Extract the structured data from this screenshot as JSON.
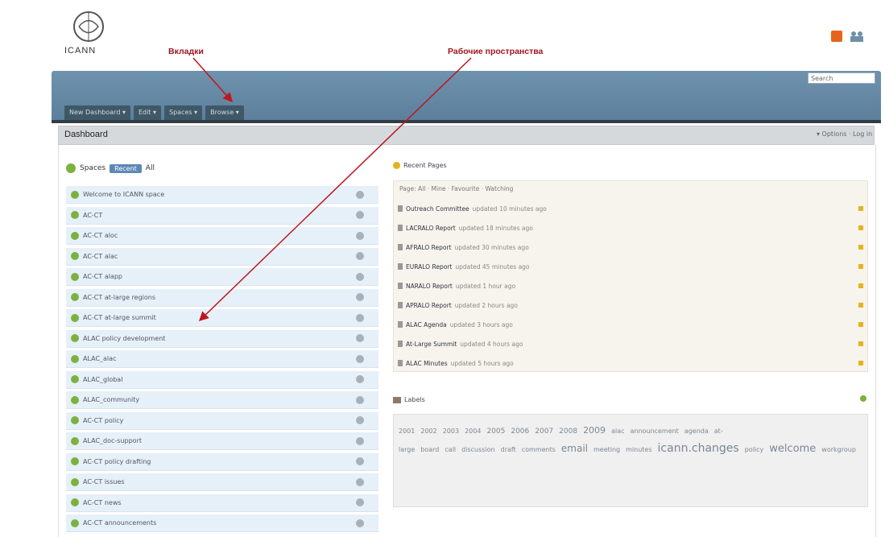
{
  "annotations": {
    "tabs": "Вкладки",
    "workspaces": "Рабочие пространства"
  },
  "logo_text": "ICANN",
  "search": {
    "placeholder": "Search"
  },
  "tabs": [
    "New Dashboard ▾",
    "Edit ▾",
    "Spaces ▾",
    "Browse ▾"
  ],
  "dashboard": {
    "title": "Dashboard",
    "right": "▾ Options · Log in"
  },
  "spaces": {
    "label": "Spaces",
    "filter_active": "Recent",
    "filter_other": "All",
    "items": [
      "Welcome to ICANN space",
      "AC-CT",
      "AC-CT aloc",
      "AC-CT alac",
      "AC-CT alapp",
      "AC-CT at-large regions",
      "AC-CT at-large summit",
      "ALAC policy development",
      "ALAC_alac",
      "ALAC_global",
      "ALAC_community",
      "AC-CT policy",
      "ALAC_doc-support",
      "AC-CT policy drafting",
      "AC-CT issues",
      "AC-CT news",
      "AC-CT announcements"
    ]
  },
  "pages": {
    "title": "Recent Pages",
    "filter": "Page: All · Mine · Favourite · Watching",
    "items": [
      {
        "title": "Outreach Committee",
        "desc": "updated 10 minutes ago"
      },
      {
        "title": "LACRALO Report",
        "desc": "updated 18 minutes ago"
      },
      {
        "title": "AFRALO Report",
        "desc": "updated 30 minutes ago"
      },
      {
        "title": "EURALO Report",
        "desc": "updated 45 minutes ago"
      },
      {
        "title": "NARALO Report",
        "desc": "updated 1 hour ago"
      },
      {
        "title": "APRALO Report",
        "desc": "updated 2 hours ago"
      },
      {
        "title": "ALAC Agenda",
        "desc": "updated 3 hours ago"
      },
      {
        "title": "At-Large Summit",
        "desc": "updated 4 hours ago"
      },
      {
        "title": "ALAC Minutes",
        "desc": "updated 5 hours ago"
      }
    ]
  },
  "labels": {
    "title": "Labels",
    "cloud": [
      {
        "t": "2001",
        "s": 8
      },
      {
        "t": "2002",
        "s": 8
      },
      {
        "t": "2003",
        "s": 8
      },
      {
        "t": "2004",
        "s": 8
      },
      {
        "t": "2005",
        "s": 9
      },
      {
        "t": "2006",
        "s": 9
      },
      {
        "t": "2007",
        "s": 9
      },
      {
        "t": "2008",
        "s": 9
      },
      {
        "t": "2009",
        "s": 11
      },
      {
        "t": "alac",
        "s": 8
      },
      {
        "t": "announcement",
        "s": 8
      },
      {
        "t": "agenda",
        "s": 8
      },
      {
        "t": "at-large",
        "s": 8
      },
      {
        "t": "board",
        "s": 8
      },
      {
        "t": "call",
        "s": 8
      },
      {
        "t": "discussion",
        "s": 8
      },
      {
        "t": "draft",
        "s": 8
      },
      {
        "t": "comments",
        "s": 8
      },
      {
        "t": "email",
        "s": 12
      },
      {
        "t": "meeting",
        "s": 8
      },
      {
        "t": "minutes",
        "s": 8
      },
      {
        "t": "icann.changes",
        "s": 14
      },
      {
        "t": "policy",
        "s": 8
      },
      {
        "t": "welcome",
        "s": 13
      },
      {
        "t": "workgroup",
        "s": 8
      }
    ]
  },
  "colors": {
    "banner": "#6f92ad",
    "annotation": "#a0141e",
    "space_row": "#e6f0f8"
  }
}
